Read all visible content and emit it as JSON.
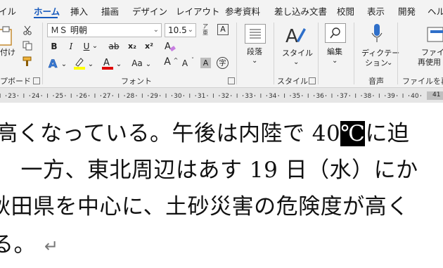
{
  "tabs": [
    "イル",
    "ホーム",
    "挿入",
    "描画",
    "デザイン",
    "レイアウト",
    "参考資料",
    "差し込み文書",
    "校閲",
    "表示",
    "開発",
    "ヘル"
  ],
  "active_tab": "ホーム",
  "clipboard": {
    "paste_label": "付け",
    "group_label": "プボード"
  },
  "font": {
    "name": "ＭＳ 明朝",
    "size": "10.5",
    "group_label": "フォント",
    "bold": "B",
    "italic": "I",
    "underline": "U",
    "strike": "ab",
    "subscript": "x₂",
    "superscript": "x²",
    "grow": "A",
    "shrink": "A",
    "case": "Aa"
  },
  "paragraph": {
    "label": "段落"
  },
  "styles": {
    "label": "スタイル",
    "group_label": "スタイル"
  },
  "editing": {
    "label": "編集"
  },
  "voice": {
    "dictate_label_1": "ディクテー",
    "dictate_label_2": "ション",
    "group_label": "音声"
  },
  "files": {
    "label_1": "ファイル",
    "label_2": "再使用",
    "group_label": "ファイルを再"
  },
  "ruler": {
    "numbers": [
      "23",
      "24",
      "25",
      "26",
      "27",
      "28",
      "29",
      "30",
      "31",
      "32",
      "33",
      "34",
      "35",
      "36",
      "37",
      "38",
      "39",
      "40"
    ],
    "marker": "41"
  },
  "document": {
    "line1_pre": "高くなっている。午後は内陸で 40",
    "line1_sel": "℃",
    "line1_post": "に迫",
    "line2": "　一方、東北周辺はあす 19 日（水）にか",
    "line3": "秋田県を中心に、土砂災害の危険度が高く",
    "line4": "る。",
    "return_mark": "↵"
  },
  "colors": {
    "accent": "#185abd",
    "highlight": "#ffff00",
    "font_color": "#e00000"
  }
}
